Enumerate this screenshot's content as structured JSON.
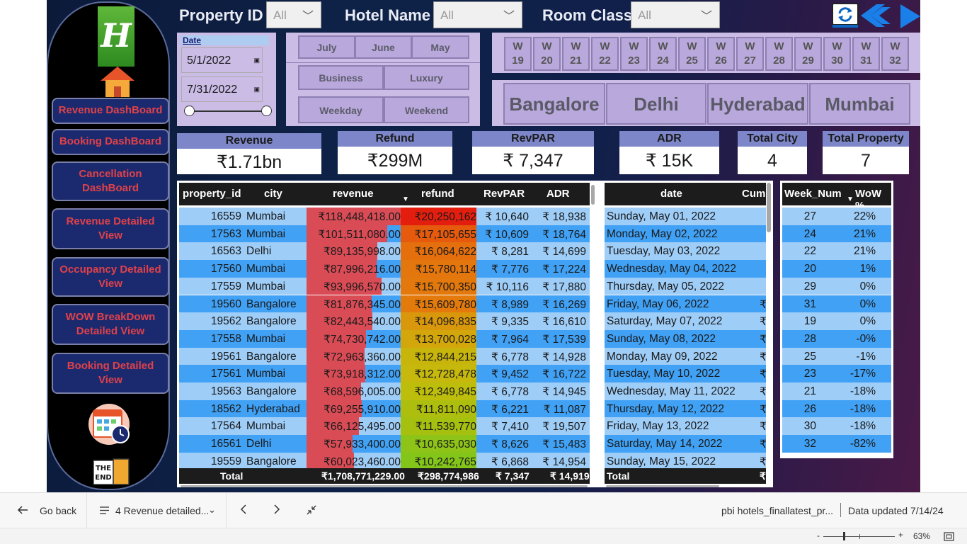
{
  "nav": {
    "items": [
      "Revenue DashBoard",
      "Booking DashBoard",
      "Cancellation DashBoard",
      "Revenue Detailed View",
      "Occupancy Detailed View",
      "WOW BreakDown Detailed View",
      "Booking Detailed View"
    ]
  },
  "slicers": {
    "property_label": "Property ID",
    "property_value": "All",
    "hotel_label": "Hotel Name",
    "hotel_value": "All",
    "room_label": "Room Class",
    "room_value": "All"
  },
  "date_slicer": {
    "label": "Date",
    "start": "5/1/2022",
    "end": "7/31/2022"
  },
  "months": [
    "July",
    "June",
    "May"
  ],
  "categories": [
    "Business",
    "Luxury",
    "Weekday",
    "Weekend"
  ],
  "weeks": [
    {
      "w": "W",
      "n": "19"
    },
    {
      "w": "W",
      "n": "20"
    },
    {
      "w": "W",
      "n": "21"
    },
    {
      "w": "W",
      "n": "22"
    },
    {
      "w": "W",
      "n": "23"
    },
    {
      "w": "W",
      "n": "24"
    },
    {
      "w": "W",
      "n": "25"
    },
    {
      "w": "W",
      "n": "26"
    },
    {
      "w": "W",
      "n": "27"
    },
    {
      "w": "W",
      "n": "28"
    },
    {
      "w": "W",
      "n": "29"
    },
    {
      "w": "W",
      "n": "30"
    },
    {
      "w": "W",
      "n": "31"
    },
    {
      "w": "W",
      "n": "32"
    }
  ],
  "cities": [
    "Bangalore",
    "Delhi",
    "Hyderabad",
    "Mumbai"
  ],
  "cards": [
    {
      "title": "Revenue",
      "value": "₹1.71bn"
    },
    {
      "title": "Refund",
      "value": "₹299M"
    },
    {
      "title": "RevPAR",
      "value": "₹ 7,347"
    },
    {
      "title": "ADR",
      "value": "₹ 15K"
    },
    {
      "title": "Total City",
      "value": "4"
    },
    {
      "title": "Total Property",
      "value": "7"
    }
  ],
  "main_table": {
    "headers": [
      "property_id",
      "city",
      "revenue",
      "refund",
      "RevPAR",
      "ADR"
    ],
    "rows": [
      {
        "property_id": "16559",
        "city": "Mumbai",
        "revenue": "₹118,448,418.00",
        "refund": "₹20,250,162",
        "revpar": "₹ 10,640",
        "adr": "₹ 18,938",
        "rev_pct": 1.0,
        "ref_color": "#e41e0e"
      },
      {
        "property_id": "17563",
        "city": "Mumbai",
        "revenue": "₹101,511,080.00",
        "refund": "₹17,105,655",
        "revpar": "₹ 10,609",
        "adr": "₹ 18,764",
        "rev_pct": 0.857,
        "ref_color": "#e55a0d"
      },
      {
        "property_id": "16563",
        "city": "Delhi",
        "revenue": "₹89,135,998.00",
        "refund": "₹16,064,622",
        "revpar": "₹ 8,281",
        "adr": "₹ 14,699",
        "rev_pct": 0.753,
        "ref_color": "#e46f0c"
      },
      {
        "property_id": "17560",
        "city": "Mumbai",
        "revenue": "₹87,996,216.00",
        "refund": "₹15,780,114",
        "revpar": "₹ 7,776",
        "adr": "₹ 17,224",
        "rev_pct": 0.743,
        "ref_color": "#e3760c"
      },
      {
        "property_id": "17559",
        "city": "Mumbai",
        "revenue": "₹93,996,570.00",
        "refund": "₹15,700,350",
        "revpar": "₹ 10,116",
        "adr": "₹ 17,880",
        "rev_pct": 0.794,
        "ref_color": "#e3780c"
      },
      {
        "property_id": "19560",
        "city": "Bangalore",
        "revenue": "₹81,876,345.00",
        "refund": "₹15,609,780",
        "revpar": "₹ 8,989",
        "adr": "₹ 16,269",
        "rev_pct": 0.691,
        "ref_color": "#e37a0c"
      },
      {
        "property_id": "19562",
        "city": "Bangalore",
        "revenue": "₹82,443,540.00",
        "refund": "₹14,096,835",
        "revpar": "₹ 9,335",
        "adr": "₹ 16,610",
        "rev_pct": 0.696,
        "ref_color": "#d9980c"
      },
      {
        "property_id": "17558",
        "city": "Mumbai",
        "revenue": "₹74,730,742.00",
        "refund": "₹13,700,028",
        "revpar": "₹ 7,964",
        "adr": "₹ 17,539",
        "rev_pct": 0.631,
        "ref_color": "#d3a70c"
      },
      {
        "property_id": "19561",
        "city": "Bangalore",
        "revenue": "₹72,963,360.00",
        "refund": "₹12,844,215",
        "revpar": "₹ 6,778",
        "adr": "₹ 14,928",
        "rev_pct": 0.616,
        "ref_color": "#c8b50c"
      },
      {
        "property_id": "17561",
        "city": "Mumbai",
        "revenue": "₹73,918,312.00",
        "refund": "₹12,728,478",
        "revpar": "₹ 9,452",
        "adr": "₹ 16,722",
        "rev_pct": 0.624,
        "ref_color": "#c6b80c"
      },
      {
        "property_id": "19563",
        "city": "Bangalore",
        "revenue": "₹68,596,005.00",
        "refund": "₹12,349,845",
        "revpar": "₹ 6,778",
        "adr": "₹ 14,945",
        "rev_pct": 0.579,
        "ref_color": "#bdbd0c"
      },
      {
        "property_id": "18562",
        "city": "Hyderabad",
        "revenue": "₹69,255,910.00",
        "refund": "₹11,811,090",
        "revpar": "₹ 6,221",
        "adr": "₹ 11,087",
        "rev_pct": 0.585,
        "ref_color": "#aebe0f"
      },
      {
        "property_id": "17564",
        "city": "Mumbai",
        "revenue": "₹66,125,495.00",
        "refund": "₹11,539,770",
        "revpar": "₹ 7,410",
        "adr": "₹ 19,507",
        "rev_pct": 0.558,
        "ref_color": "#a6c010"
      },
      {
        "property_id": "16561",
        "city": "Delhi",
        "revenue": "₹57,933,400.00",
        "refund": "₹10,635,030",
        "revpar": "₹ 8,626",
        "adr": "₹ 15,483",
        "rev_pct": 0.489,
        "ref_color": "#8ec417"
      },
      {
        "property_id": "19559",
        "city": "Bangalore",
        "revenue": "₹60,023,460.00",
        "refund": "₹10,242,765",
        "revpar": "₹ 6,868",
        "adr": "₹ 14,954",
        "rev_pct": 0.507,
        "ref_color": "#84c51a"
      }
    ],
    "total": {
      "label": "Total",
      "revenue": "₹1,708,771,229.00",
      "refund": "₹298,774,986",
      "revpar": "₹ 7,347",
      "adr": "₹ 14,919"
    }
  },
  "date_table": {
    "headers": [
      "date",
      "Cum"
    ],
    "rows": [
      "Sunday, May 01, 2022",
      "Monday, May 02, 2022",
      "Tuesday, May 03, 2022",
      "Wednesday, May 04, 2022",
      "Thursday, May 05, 2022",
      "Friday, May 06, 2022",
      "Saturday, May 07, 2022",
      "Sunday, May 08, 2022",
      "Monday, May 09, 2022",
      "Tuesday, May 10, 2022",
      "Wednesday, May 11, 2022",
      "Thursday, May 12, 2022",
      "Friday, May 13, 2022",
      "Saturday, May 14, 2022",
      "Sunday, May 15, 2022"
    ],
    "cum": [
      "",
      "",
      "",
      "",
      "",
      "₹",
      "₹",
      "₹",
      "₹",
      "₹",
      "₹",
      "₹",
      "₹",
      "₹",
      "₹"
    ],
    "total": "Total",
    "total_cum": "₹"
  },
  "wow_table": {
    "headers": [
      "Week_Num",
      "WoW %"
    ],
    "rows": [
      {
        "week": "27",
        "pct": "22%"
      },
      {
        "week": "24",
        "pct": "21%"
      },
      {
        "week": "22",
        "pct": "21%"
      },
      {
        "week": "20",
        "pct": "1%"
      },
      {
        "week": "29",
        "pct": "0%"
      },
      {
        "week": "31",
        "pct": "0%"
      },
      {
        "week": "19",
        "pct": "0%"
      },
      {
        "week": "28",
        "pct": "-0%"
      },
      {
        "week": "25",
        "pct": "-1%"
      },
      {
        "week": "23",
        "pct": "-17%"
      },
      {
        "week": "21",
        "pct": "-18%"
      },
      {
        "week": "26",
        "pct": "-18%"
      },
      {
        "week": "30",
        "pct": "-18%"
      },
      {
        "week": "32",
        "pct": "-82%"
      }
    ]
  },
  "bottombar": {
    "go_back": "Go back",
    "page_selector": "4 Revenue detailed...",
    "file_name": "pbi hotels_finallatest_pr...",
    "data_updated": "Data updated 7/14/24",
    "zoom": "63%"
  },
  "colors": {
    "row_light": "#9ecdf8",
    "row_dark": "#41a1f5",
    "revenue_bar": "#d94c56",
    "nav_text": "#e0414a",
    "slicer_panel": "#cbbce6"
  }
}
